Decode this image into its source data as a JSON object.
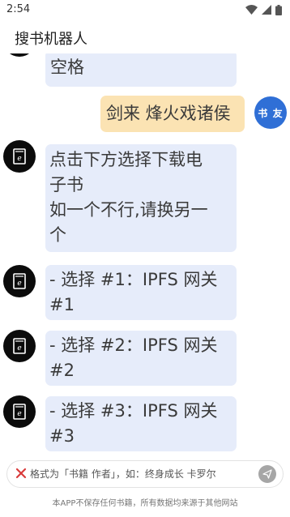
{
  "status_bar": {
    "time": "2:54",
    "icons": [
      "wifi-icon",
      "signal-icon",
      "battery-icon"
    ]
  },
  "app_bar": {
    "title": "搜书机器人"
  },
  "chat": {
    "messages": [
      {
        "sender": "bot",
        "text": "空格"
      },
      {
        "sender": "user",
        "avatar_label": "书 友",
        "text": "剑来 烽火戏诸侯"
      },
      {
        "sender": "bot",
        "avatar_icon": "ebook-icon",
        "text": "点击下方选择下载电\n子书\n如一个不行,请换另一\n个"
      },
      {
        "sender": "bot",
        "avatar_icon": "ebook-icon",
        "text": "- 选择 #1：IPFS 网关\n#1"
      },
      {
        "sender": "bot",
        "avatar_icon": "ebook-icon",
        "text": "- 选择 #2：IPFS 网关\n#2"
      },
      {
        "sender": "bot",
        "avatar_icon": "ebook-icon",
        "text": "- 选择 #3：IPFS 网关\n#3"
      }
    ]
  },
  "input": {
    "placeholder": "格式为「书籍 作者」，如：终身成长 卡罗尔",
    "value": "",
    "clear_icon": "close-icon",
    "send_icon": "send-icon"
  },
  "footer": {
    "note": "本APP不保存任何书籍，所有数据均来源于其他网站"
  },
  "colors": {
    "bot_bubble": "#e6ecfa",
    "user_bubble": "#fbe3b3",
    "user_avatar": "#2f6fd6",
    "bot_avatar": "#0b0b0b",
    "clear_icon": "#d93b3b",
    "send_button": "#a6a6a6"
  }
}
